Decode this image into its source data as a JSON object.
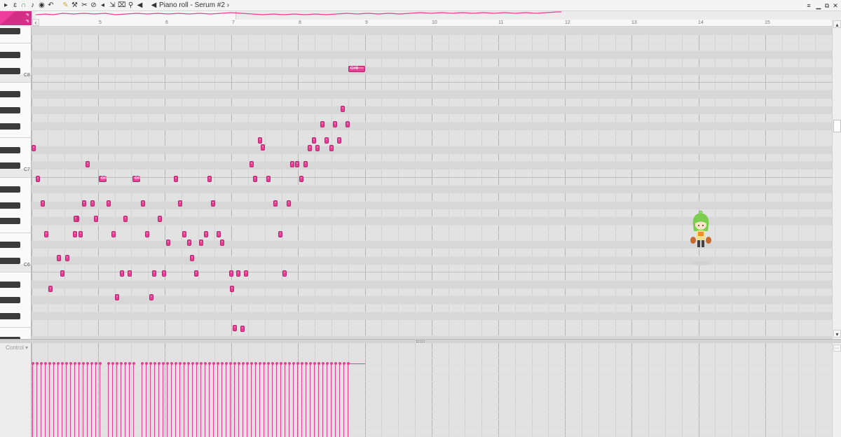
{
  "window": {
    "title": "Piano roll - Serum #2",
    "title_chevron": "›",
    "menu_arrow": "▸",
    "more_icon": "≡",
    "minimize_icon": "▁",
    "restore_icon": "⧉",
    "close_icon": "✕"
  },
  "toolbar": {
    "tools": [
      {
        "name": "tool-options-icon",
        "glyph": "▸"
      },
      {
        "name": "magnet-snap-icon",
        "glyph": "ↄ"
      },
      {
        "name": "stamp-icon",
        "glyph": "∩"
      },
      {
        "name": "playback-note-icon",
        "glyph": "♪"
      },
      {
        "name": "record-icon",
        "glyph": "◉"
      },
      {
        "name": "undo-icon",
        "glyph": "↶"
      },
      {
        "name": "pencil-draw-icon",
        "glyph": "✎"
      },
      {
        "name": "paint-brush-icon",
        "glyph": "⚒"
      },
      {
        "name": "delete-icon",
        "glyph": "✂"
      },
      {
        "name": "mute-icon",
        "glyph": "⊘"
      },
      {
        "name": "slip-icon",
        "glyph": "◂"
      },
      {
        "name": "select-icon",
        "glyph": "⇲"
      },
      {
        "name": "slice-icon",
        "glyph": "⌧"
      },
      {
        "name": "zoom-icon",
        "glyph": "⚲"
      },
      {
        "name": "speaker-icon",
        "glyph": "◀"
      },
      {
        "name": "speaker-play-icon",
        "glyph": "◀"
      }
    ]
  },
  "ruler": {
    "bars": [
      "5",
      "6",
      "7",
      "8",
      "9",
      "10",
      "11",
      "12",
      "13",
      "14",
      "15"
    ],
    "left_button": "‹",
    "right_button": "›"
  },
  "keyboard": {
    "labels": [
      "C8",
      "C7",
      "C6"
    ]
  },
  "scroll": {
    "up": "▴",
    "down": "▾"
  },
  "notes": {
    "label_c8": "C#8",
    "label_g6a": "G6",
    "label_g6b": "G6"
  },
  "control": {
    "label": "Control",
    "arrow": "▾",
    "button": "···",
    "level": 1.0
  },
  "colors": {
    "accent": "#ea3d94",
    "accent_dark": "#b5286f",
    "grid_dark": "#d7d7d7"
  }
}
